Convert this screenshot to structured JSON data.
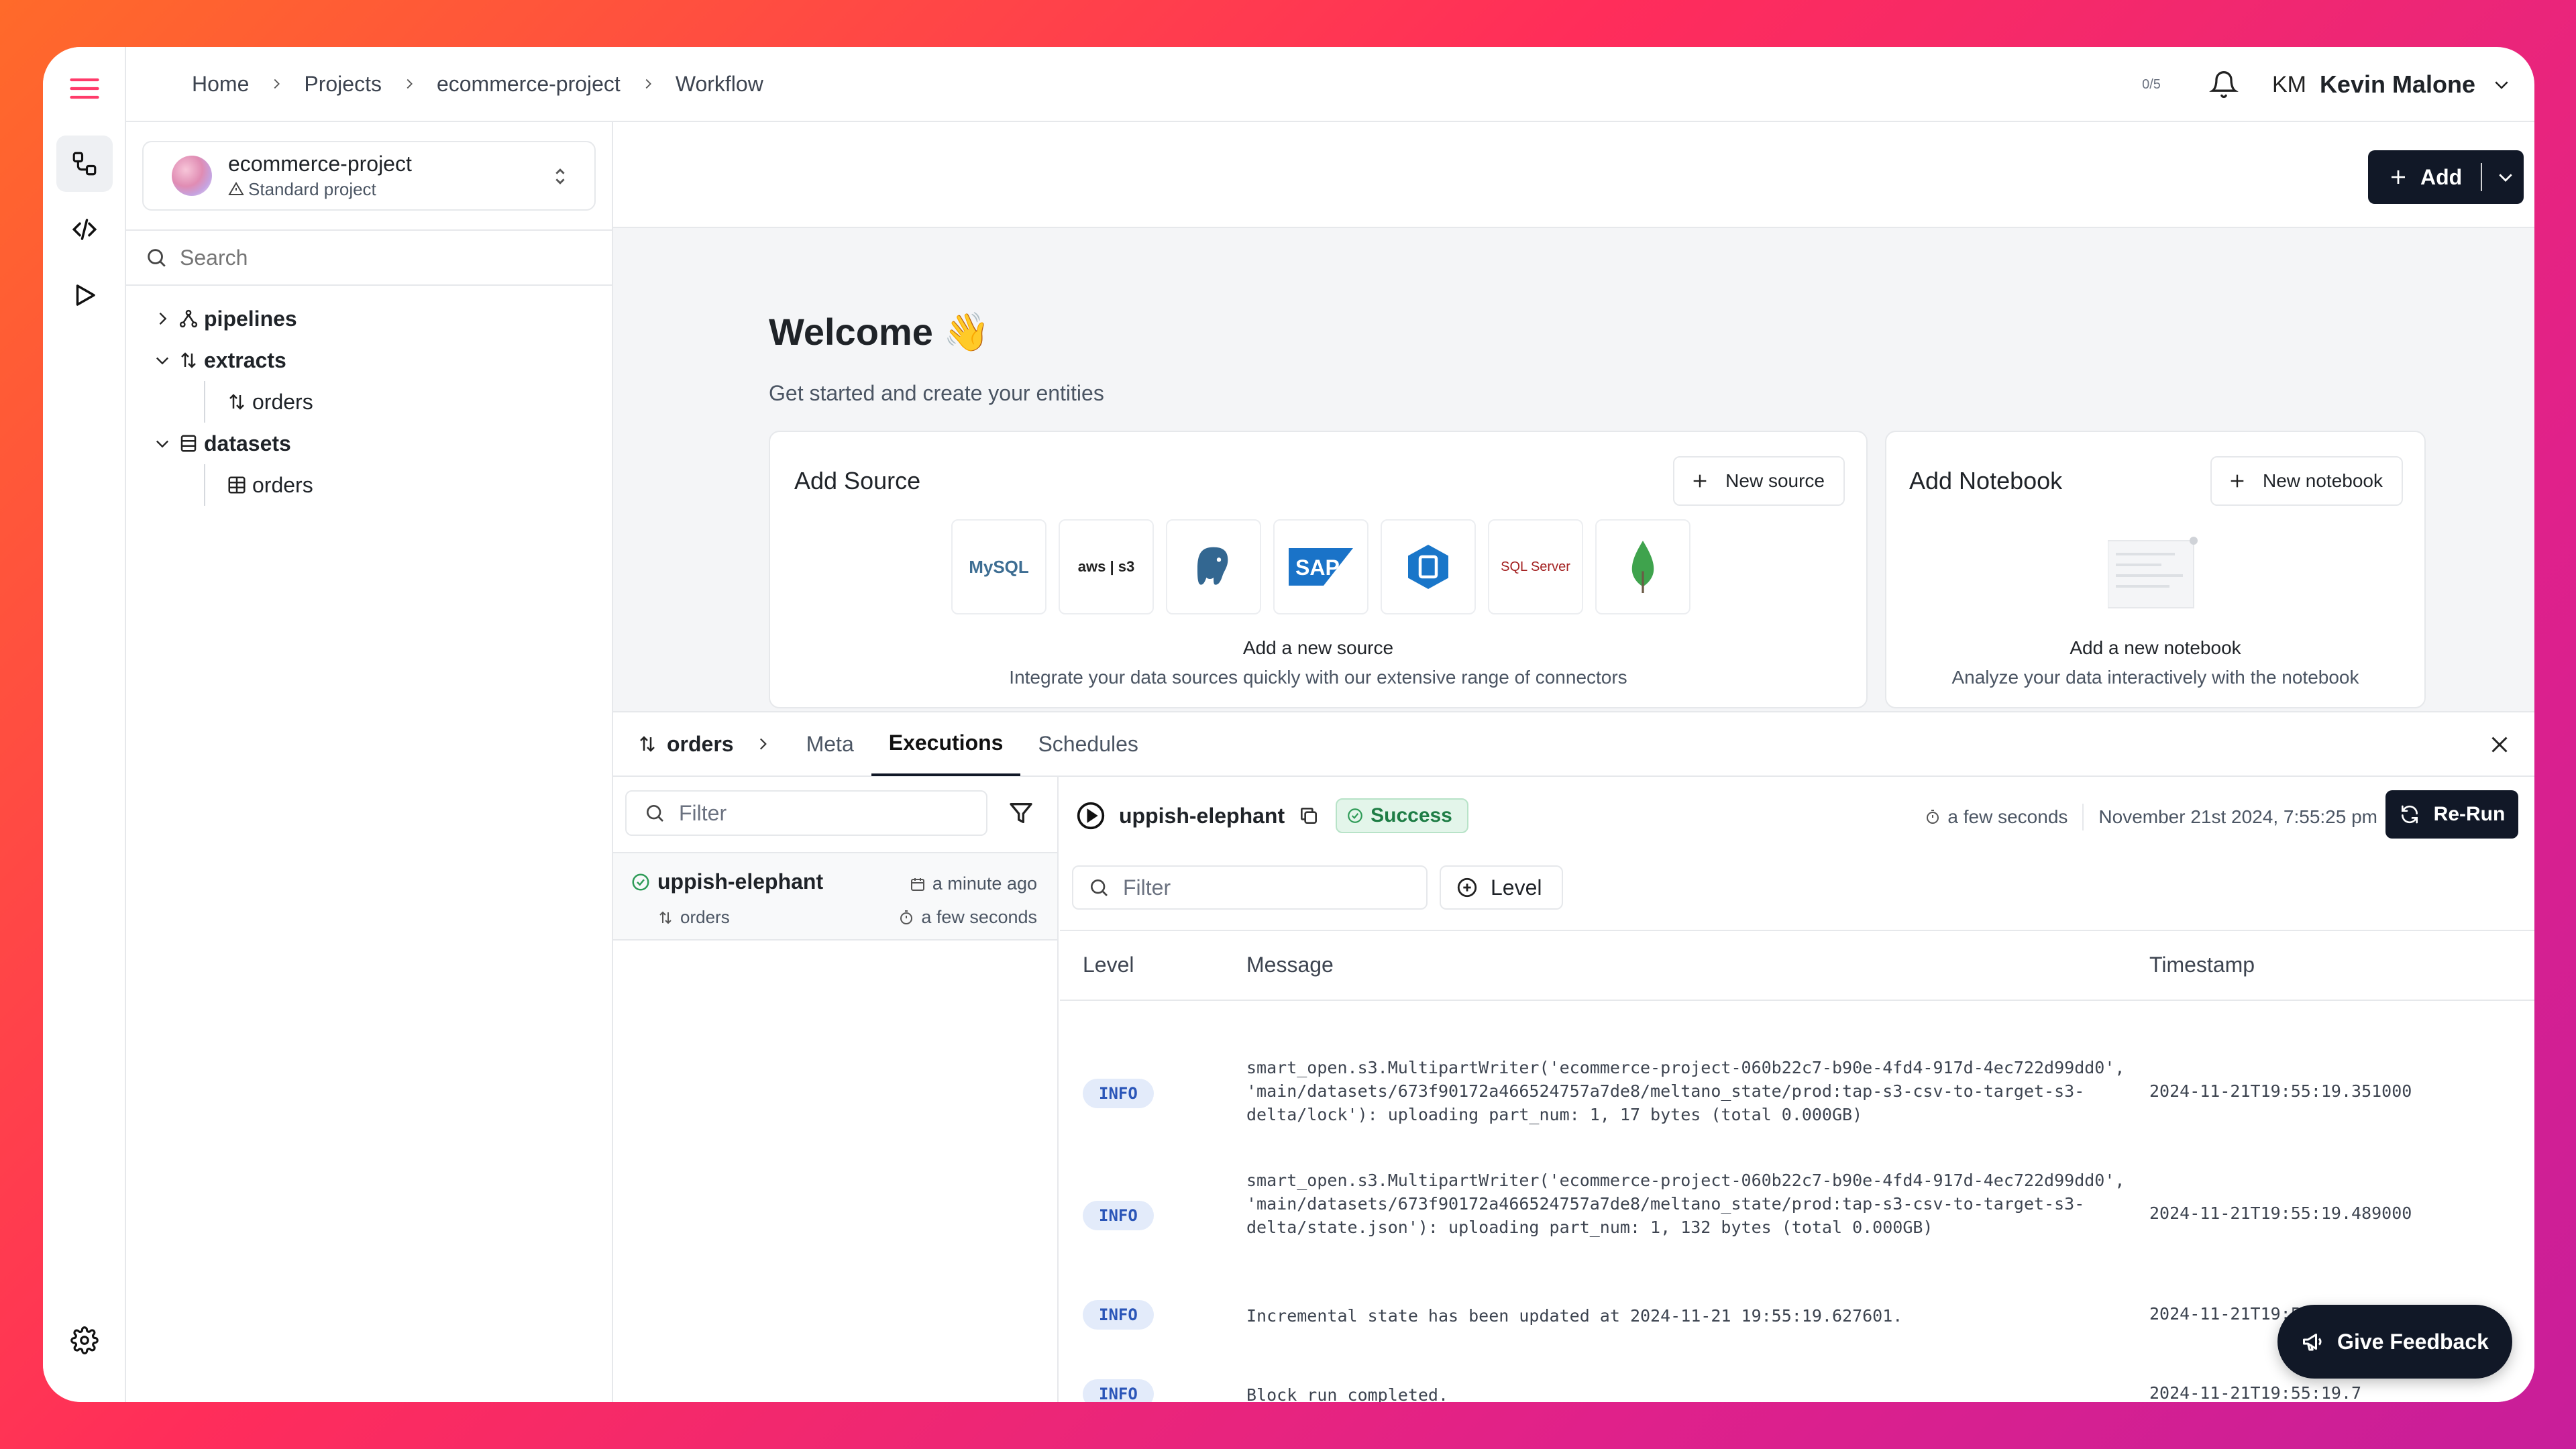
{
  "breadcrumbs": [
    "Home",
    "Projects",
    "ecommerce-project",
    "Workflow"
  ],
  "header": {
    "counter": "0/5",
    "user_initials": "KM",
    "user_name": "Kevin Malone"
  },
  "project": {
    "name": "ecommerce-project",
    "type": "Standard project"
  },
  "sidebar": {
    "search_placeholder": "Search",
    "tree": [
      {
        "label": "pipelines",
        "expanded": false,
        "children": []
      },
      {
        "label": "extracts",
        "expanded": true,
        "children": [
          "orders"
        ]
      },
      {
        "label": "datasets",
        "expanded": true,
        "children": [
          "orders"
        ]
      }
    ]
  },
  "main": {
    "add_label": "Add",
    "welcome_title": "Welcome 👋",
    "welcome_sub": "Get started and create your entities",
    "source_card": {
      "title": "Add Source",
      "button": "New source",
      "caption": "Add a new source",
      "desc": "Integrate your data sources quickly with our extensive range of connectors",
      "connectors": [
        "MySQL",
        "aws | s3",
        "PostgreSQL",
        "SAP",
        "Azure",
        "SQL Server",
        "MongoDB"
      ]
    },
    "notebook_card": {
      "title": "Add Notebook",
      "button": "New notebook",
      "caption": "Add a new notebook",
      "desc": "Analyze your data interactively with the notebook"
    }
  },
  "bottom": {
    "entity": "orders",
    "tabs": [
      "Meta",
      "Executions",
      "Schedules"
    ],
    "active_tab": "Executions",
    "filter_placeholder": "Filter",
    "execution": {
      "name": "uppish-elephant",
      "extract": "orders",
      "when": "a minute ago",
      "duration": "a few seconds"
    },
    "run": {
      "name": "uppish-elephant",
      "status": "Success",
      "duration": "a few seconds",
      "datetime": "November 21st 2024, 7:55:25 pm",
      "rerun_label": "Re-Run",
      "log_filter_placeholder": "Filter",
      "level_button": "Level"
    },
    "log_columns": [
      "Level",
      "Message",
      "Timestamp"
    ],
    "logs": [
      {
        "level": "INFO",
        "message": "smart_open.s3.MultipartWriter('ecommerce-project-060b22c7-b90e-4fd4-917d-4ec722d99dd0', 'main/datasets/673f90172a466524757a7de8/meltano_state/prod:tap-s3-csv-to-target-s3-delta/lock'): uploading part_num: 1, 17 bytes (total 0.000GB)",
        "timestamp": "2024-11-21T19:55:19.351000"
      },
      {
        "level": "INFO",
        "message": "smart_open.s3.MultipartWriter('ecommerce-project-060b22c7-b90e-4fd4-917d-4ec722d99dd0', 'main/datasets/673f90172a466524757a7de8/meltano_state/prod:tap-s3-csv-to-target-s3-delta/state.json'): uploading part_num: 1, 132 bytes (total 0.000GB)",
        "timestamp": "2024-11-21T19:55:19.489000"
      },
      {
        "level": "INFO",
        "message": "Incremental state has been updated at 2024-11-21 19:55:19.627601.",
        "timestamp": "2024-11-21T19:55:19.628000"
      },
      {
        "level": "INFO",
        "message": "Block run completed.",
        "timestamp": "2024-11-21T19:55:19.7"
      }
    ]
  },
  "feedback_label": "Give Feedback"
}
